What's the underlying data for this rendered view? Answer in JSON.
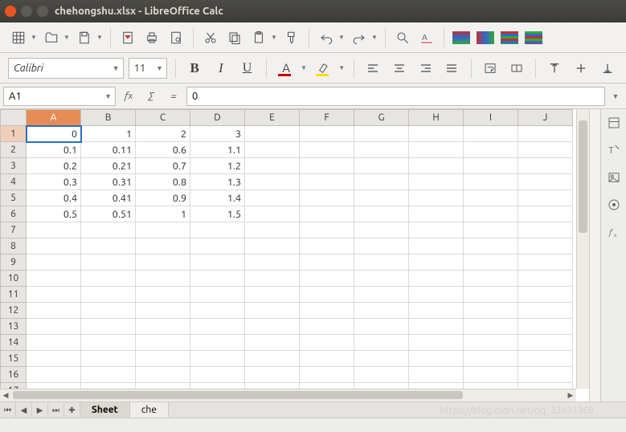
{
  "window": {
    "title": "chehongshu.xlsx - LibreOffice Calc"
  },
  "font": {
    "name": "Calibri",
    "size": "11"
  },
  "cellref": {
    "value": "A1"
  },
  "formula": {
    "value": "0"
  },
  "columns": [
    "A",
    "B",
    "C",
    "D",
    "E",
    "F",
    "G",
    "H",
    "I",
    "J"
  ],
  "rows": [
    "1",
    "2",
    "3",
    "4",
    "5",
    "6",
    "7",
    "8",
    "9",
    "10",
    "11",
    "12",
    "13",
    "14",
    "15",
    "16",
    "17"
  ],
  "active": {
    "col": 0,
    "row": 0
  },
  "cells": [
    [
      "0",
      "1",
      "2",
      "3",
      "",
      "",
      "",
      "",
      "",
      ""
    ],
    [
      "0.1",
      "0.11",
      "0.6",
      "1.1",
      "",
      "",
      "",
      "",
      "",
      ""
    ],
    [
      "0.2",
      "0.21",
      "0.7",
      "1.2",
      "",
      "",
      "",
      "",
      "",
      ""
    ],
    [
      "0.3",
      "0.31",
      "0.8",
      "1.3",
      "",
      "",
      "",
      "",
      "",
      ""
    ],
    [
      "0.4",
      "0.41",
      "0.9",
      "1.4",
      "",
      "",
      "",
      "",
      "",
      ""
    ],
    [
      "0.5",
      "0.51",
      "1",
      "1.5",
      "",
      "",
      "",
      "",
      "",
      ""
    ],
    [
      "",
      "",
      "",
      "",
      "",
      "",
      "",
      "",
      "",
      ""
    ],
    [
      "",
      "",
      "",
      "",
      "",
      "",
      "",
      "",
      "",
      ""
    ],
    [
      "",
      "",
      "",
      "",
      "",
      "",
      "",
      "",
      "",
      ""
    ],
    [
      "",
      "",
      "",
      "",
      "",
      "",
      "",
      "",
      "",
      ""
    ],
    [
      "",
      "",
      "",
      "",
      "",
      "",
      "",
      "",
      "",
      ""
    ],
    [
      "",
      "",
      "",
      "",
      "",
      "",
      "",
      "",
      "",
      ""
    ],
    [
      "",
      "",
      "",
      "",
      "",
      "",
      "",
      "",
      "",
      ""
    ],
    [
      "",
      "",
      "",
      "",
      "",
      "",
      "",
      "",
      "",
      ""
    ],
    [
      "",
      "",
      "",
      "",
      "",
      "",
      "",
      "",
      "",
      ""
    ],
    [
      "",
      "",
      "",
      "",
      "",
      "",
      "",
      "",
      "",
      ""
    ],
    [
      "",
      "",
      "",
      "",
      "",
      "",
      "",
      "",
      "",
      ""
    ]
  ],
  "tabs": {
    "items": [
      "Sheet",
      "che"
    ],
    "active": 0
  },
  "watermark": "https://blog.csdn.net/qq_33431368"
}
